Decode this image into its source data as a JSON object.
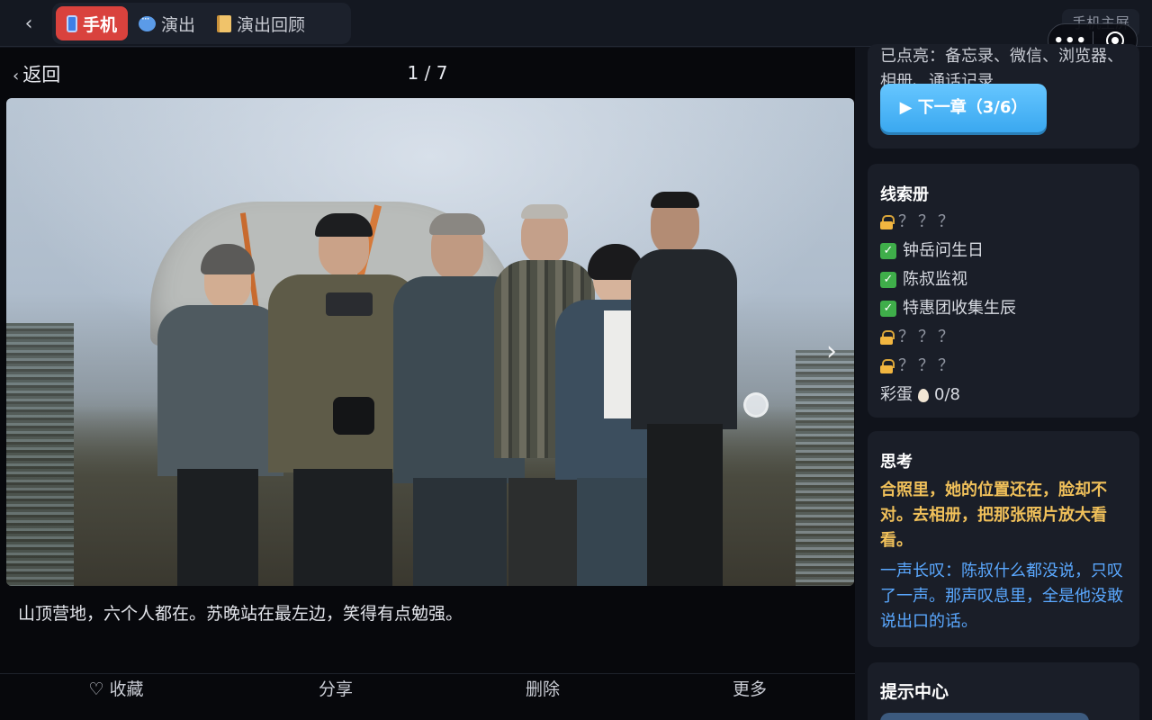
{
  "topbar": {
    "back_icon": "chevron-left-icon",
    "tabs": [
      {
        "label": "手机",
        "icon": "phone-icon",
        "active": true
      },
      {
        "label": "演出",
        "icon": "chat-bubble-icon",
        "active": false
      },
      {
        "label": "演出回顾",
        "icon": "scroll-icon",
        "active": false
      }
    ],
    "home_screen_label": "手机主屏"
  },
  "viewer": {
    "back_label": "返回",
    "counter": "1 / 7",
    "caption": "山顶营地，六个人都在。苏晚站在最左边，笑得有点勉强。",
    "actions": [
      "♡ 收藏",
      "分享",
      "删除",
      "更多"
    ]
  },
  "sidebar": {
    "progress": {
      "unlocked_text": "已点亮：备忘录、微信、浏览器、相册、通话记录",
      "next_chapter_label": "▶ 下一章（3/6）"
    },
    "clues": {
      "title": "线索册",
      "items": [
        {
          "label": "？？？",
          "locked": true
        },
        {
          "label": "钟岳问生日",
          "locked": false
        },
        {
          "label": "陈叔监视",
          "locked": false
        },
        {
          "label": "特惠团收集生辰",
          "locked": false
        },
        {
          "label": "？？？",
          "locked": true
        },
        {
          "label": "？？？",
          "locked": true
        }
      ],
      "easter_egg_label": "彩蛋",
      "easter_egg_count": "0/8"
    },
    "thinking": {
      "title": "思考",
      "main": "合照里，她的位置还在，脸却不对。去相册，把那张照片放大看看。",
      "sub": "一声长叹：陈叔什么都没说，只叹了一声。那声叹息里，全是他没敢说出口的话。"
    },
    "hints": {
      "title": "提示中心"
    }
  },
  "colors": {
    "accent_red": "#d9423d",
    "accent_blue": "#3aa8f0",
    "think_gold": "#f0c05a",
    "think_blue": "#5aa8ff"
  }
}
